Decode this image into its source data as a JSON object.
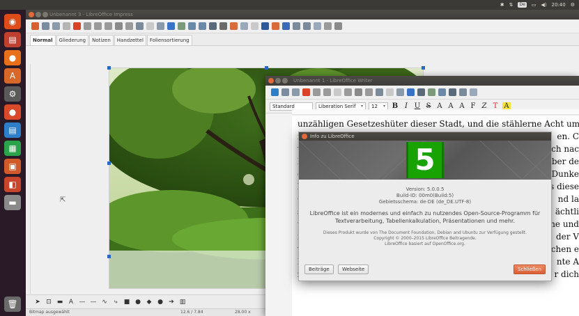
{
  "system_panel": {
    "keyboard_layout": "De",
    "clock": "20:40"
  },
  "impress": {
    "title": "Unbenannt 3 - LibreOffice Impress",
    "view_tabs": [
      {
        "label": "Normal"
      },
      {
        "label": "Gliederung"
      },
      {
        "label": "Notizen"
      },
      {
        "label": "Handzettel"
      },
      {
        "label": "Foliensortierung"
      }
    ],
    "status_left": "Bitmap ausgewählt",
    "status_mid": "12.6 / 7.84",
    "status_right": "28.00 x"
  },
  "writer": {
    "title": "Unbenannt 1 - LibreOffice Writer",
    "paragraph_style": "Standard",
    "font_name": "Liberation Serif",
    "font_size": "12",
    "doc_lines": [
      "unzähligen Gesetzeshüter dieser Stadt, und die stählerne Acht um seine Har"
    ],
    "right_fragments": [
      "en. C",
      "ch nac",
      "ber de",
      "Dunke",
      "s diese",
      "nd la",
      "ächtli",
      "he und",
      "der V",
      "chen e",
      "nte A",
      "r dich"
    ],
    "left_fragments": [
      "z",
      "v",
      "N",
      "d",
      "l",
      "G",
      "s",
      "u",
      "i",
      "v",
      "E",
      "z"
    ]
  },
  "about_dialog": {
    "title": "Info zu LibreOffice",
    "logo_text": "5",
    "version": "Version: 5.0.0.5",
    "build_id": "Build-ID: 00m0(Build:5)",
    "locale": "Gebietsschema: de-DE (de_DE.UTF-8)",
    "description": "LibreOffice ist ein modernes und einfach zu nutzendes Open-Source-Programm für Textverarbeitung, Tabellenkalkulation, Präsentationen und mehr.",
    "credits_1": "Dieses Produkt wurde von The Document Foundation, Debian and Ubuntu zur Verfügung gestellt.",
    "credits_2": "Copyright © 2000–2015 LibreOffice Beitragende.",
    "credits_3": "LibreOffice basiert auf OpenOffice.org.",
    "btn_credits": "Beiträge",
    "btn_website": "Webseite",
    "btn_close": "Schließen",
    "colors": {
      "logo_green": "#18a303",
      "close_orange": "#db5f33"
    }
  }
}
